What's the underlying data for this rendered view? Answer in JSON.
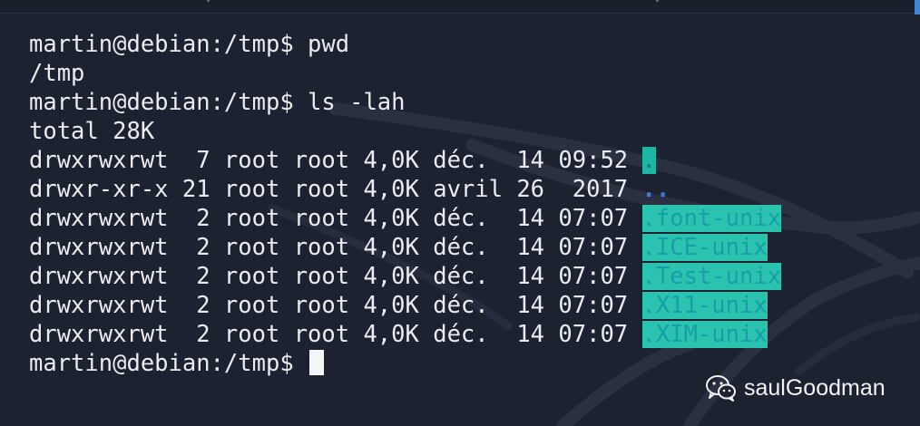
{
  "terminal": {
    "lines": [
      {
        "text": "martin@debian:/tmp$ pwd"
      },
      {
        "text": "/tmp"
      },
      {
        "text": "martin@debian:/tmp$ ls -lah"
      },
      {
        "text": "total 28K"
      },
      {
        "meta": "drwxrwxrwt  7 root root 4,0K déc.  14 09:52 ",
        "name": "."
      },
      {
        "meta": "drwxr-xr-x 21 root root 4,0K avril 26  2017 ",
        "name": ".."
      },
      {
        "meta": "drwxrwxrwt  2 root root 4,0K déc.  14 07:07 ",
        "name": ".font-unix"
      },
      {
        "meta": "drwxrwxrwt  2 root root 4,0K déc.  14 07:07 ",
        "name": ".ICE-unix"
      },
      {
        "meta": "drwxrwxrwt  2 root root 4,0K déc.  14 07:07 ",
        "name": ".Test-unix"
      },
      {
        "meta": "drwxrwxrwt  2 root root 4,0K déc.  14 07:07 ",
        "name": ".X11-unix"
      },
      {
        "meta": "drwxrwxrwt  2 root root 4,0K déc.  14 07:07 ",
        "name": ".XIM-unix"
      }
    ],
    "prompt": "martin@debian:/tmp$ "
  },
  "watermark": {
    "icon": "wechat-icon",
    "text": "saulGoodman"
  },
  "colors": {
    "background": "#1d2230",
    "foreground": "#e9ecf1",
    "highlight_bg": "#2bc3b0",
    "highlight_fg": "#16a0a6",
    "dir_blue": "#3a7fe0"
  }
}
